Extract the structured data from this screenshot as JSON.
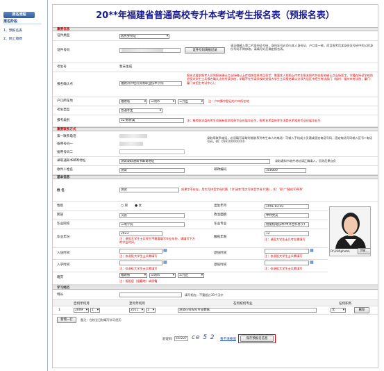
{
  "sidebar": {
    "header": "报名流程",
    "sub": "报名阶段",
    "items": [
      "1、预报名表",
      "2、网上缴费"
    ]
  },
  "form": {
    "title": "20**年福建省普通高校专升本考试考生报名表（预报名表）",
    "sections": {
      "key": "重要信息",
      "contact": "重要联系方式",
      "basic": "基本信息",
      "study": "学习经历"
    },
    "id_type": {
      "label": "证件类型",
      "value": "居民身份证"
    },
    "id_number": {
      "label": "证件号码",
      "button": "证件号码填报记录",
      "note": "请正确输入第二代身份证号码，身份证号必须与本人身份证、户口本一致，而且报考后本身份证号码中的公民身份号码不得修改，请填写好后确定报名表。"
    },
    "exam_no": {
      "label": "考生号",
      "value": "暂未生成"
    },
    "school": {
      "label": "报名确认点",
      "value": "福建对外经济贸易职业技术学院",
      "note": "报名点要求报考人员到报名确认点当场确认上传相关信息并且签字；需要本人拍照上传考生报名照片并在报名确认点当场签字。学籍在所读学校的退役大学生士兵报名确认点为所读学校，学籍不在所读学校的退役大学生士兵报名确认点须为设区市招生考试部门（福州：福州市考试院；厦门：厦门市招生考试中心）。"
    },
    "hukou": {
      "label": "户口所在地",
      "province": "福建省",
      "city": "三明市",
      "county": "三元区",
      "note": "注：户口簿中登记的户口所在地"
    },
    "exam_type": {
      "label": "考生类型",
      "value": "普通考生"
    },
    "exam_category": {
      "label": "报考类别",
      "value": "52-教育类",
      "note": "注：报考医学类的考生须具有医学相关专业应届毕业生，报考艺术类的考生须是艺术相关专业应届毕业生"
    },
    "contact": {
      "phone1": "第一联系电话",
      "phone2": "备用号码一",
      "phone3": "备用号码二",
      "phone_note": "录取用联系电话，必须填写录取时能联系到考生本人的电话！可输入手机或小灵通或固定电话号码，固定电话号码输入区号+电话号码，例：0591XXXXXXXX",
      "address_label": "录取通知书邮寄地址",
      "address_value": "测试录取通知书邮寄地址",
      "address_note": "录取通知书收件地址请正确填入，否则后果自负",
      "recipient_label": "收件人姓名",
      "recipient_value": "测试",
      "zip_label": "邮政编码",
      "zip_value": "350000"
    },
    "name": {
      "label": "姓 名",
      "value": "测试",
      "note": "如果字不存在，用大写拼音字母代替（'涂'请李'用大写拼音字母'代替），如：'郭'广'替成'ZHEN'"
    },
    "gender": {
      "label": "性别",
      "options": [
        "男",
        "女"
      ]
    },
    "birth": {
      "label": "出生年月",
      "value": "1991-03-01"
    },
    "nation": {
      "label": "民族",
      "value": "汉族"
    },
    "politics": {
      "label": "政治面貌",
      "value": "中共党员"
    },
    "grad_school": {
      "label": "毕业院校",
      "value": "三明学院"
    },
    "major": {
      "label": "毕业专业",
      "value": "智能机电技术(中外合作办学)"
    },
    "grad_year": {
      "label": "毕业年份",
      "value": "2023",
      "note": "注：退役大学生士兵考生不需要填写毕业年份，请填写下方的学业时间。"
    },
    "service_years": {
      "label": "服役年限",
      "value": "12",
      "note": "注：退役大学生士兵考生需填写"
    },
    "enlist": {
      "label": "入伍时间",
      "note": "注：仅退役大学生士兵需填写"
    },
    "discharge": {
      "label": "退伍时间",
      "note": "注：仅退役大学生士兵需填写"
    },
    "enroll": {
      "label": "入学时间",
      "note": "注：仅退役大学生士兵需填写"
    },
    "retire": {
      "label": "退役时间",
      "note": "注：仅退役大学生士兵需填写"
    },
    "origin": {
      "label": "籍贯",
      "province": "福建省",
      "city": "三明市",
      "county": "三元区",
      "note": "注：指祖居（祖籍地）或原籍"
    },
    "specialty": {
      "label": "特长",
      "note": "填写相应，不要超过30个汉字"
    },
    "photo_path": "D:\\194\\photo\\",
    "photo_button": "浏览...",
    "study_table": {
      "headers": [
        "自何年何月",
        "至何年何月",
        "在何校何专业",
        "任何职务"
      ],
      "rows": [
        {
          "no": "1",
          "from_year": "2009",
          "from_month": "1",
          "to_year": "2011",
          "to_month": "1",
          "detail": "测试在何校何专业数据",
          "role": "无",
          "action": "删除"
        }
      ]
    },
    "add_row": {
      "button": "新增一行",
      "note": "备注：在校全日制填写学习经历"
    },
    "captcha": {
      "label": "验证码",
      "value": "cec227",
      "image_text": "ce 5 2",
      "refresh": "看不清换图"
    },
    "submit": "保存预报名信息"
  }
}
